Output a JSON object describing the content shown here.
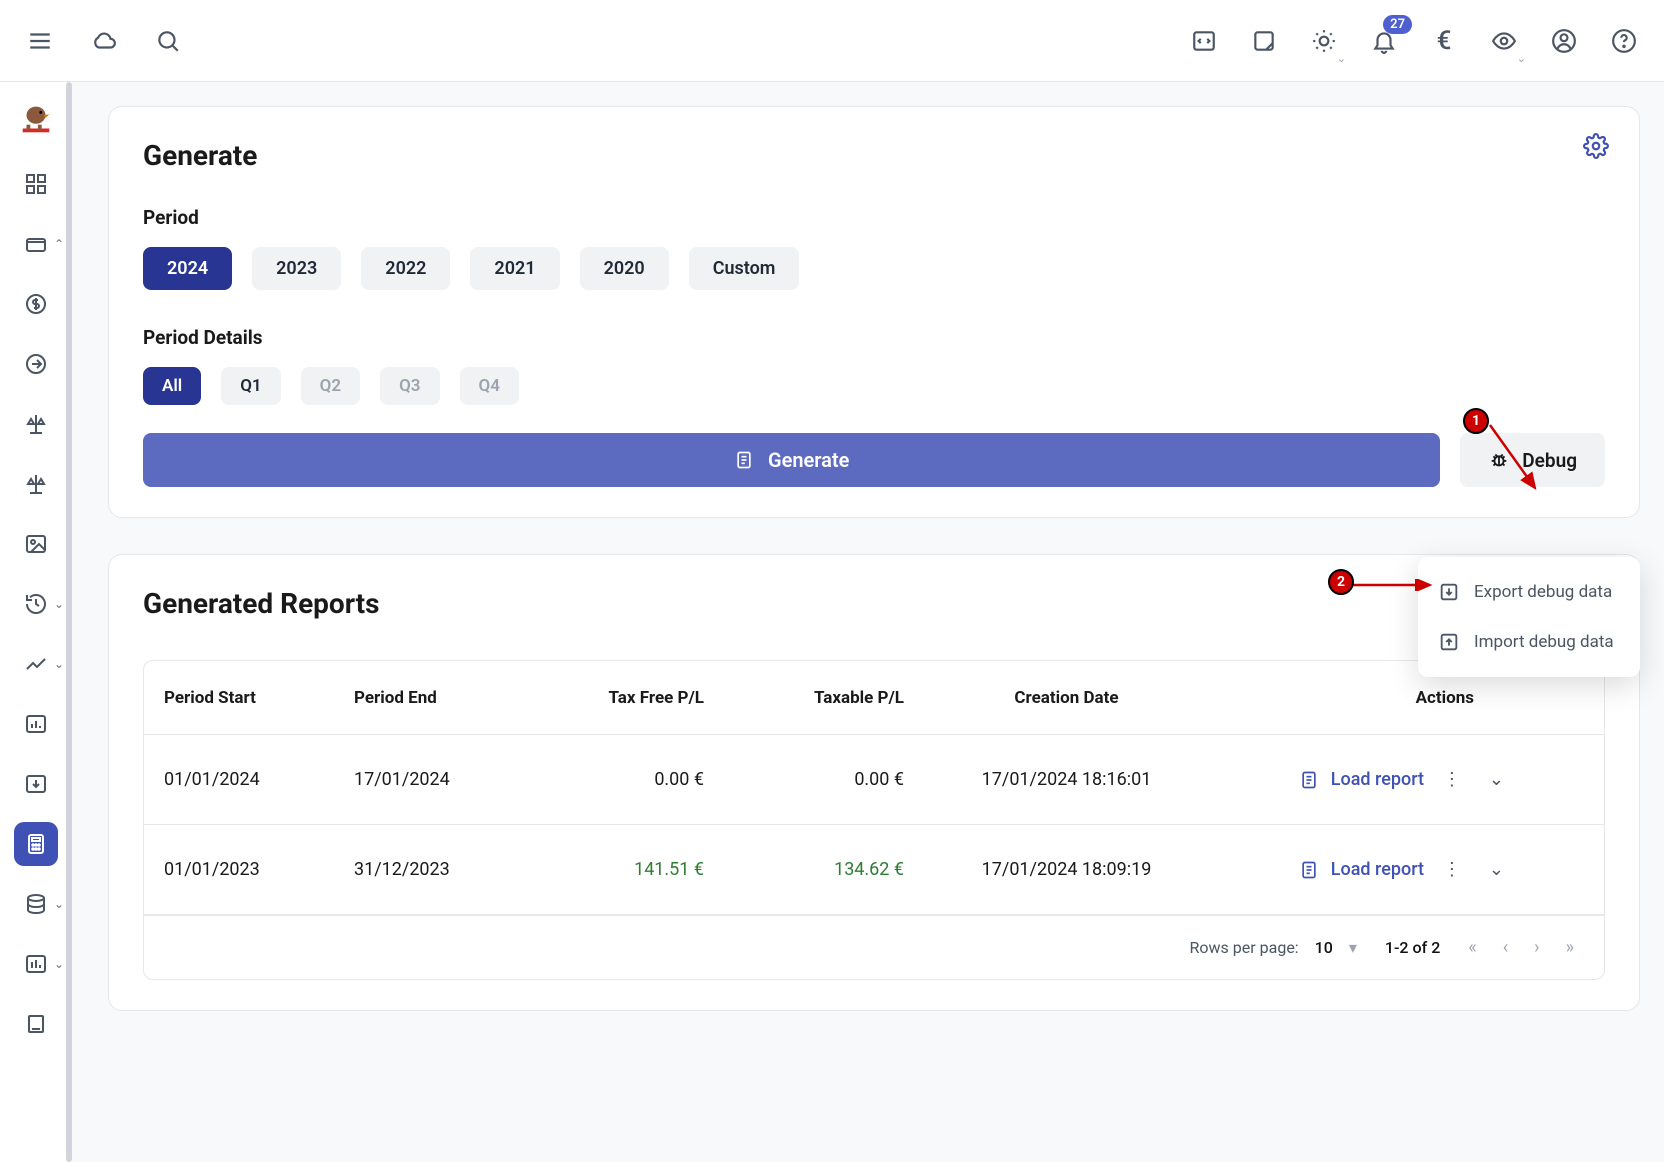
{
  "topbar": {
    "notification_count": "27",
    "currency_symbol": "€"
  },
  "generate": {
    "title": "Generate",
    "period_label": "Period",
    "periods": [
      "2024",
      "2023",
      "2022",
      "2021",
      "2020",
      "Custom"
    ],
    "period_active_index": 0,
    "details_label": "Period Details",
    "details": [
      {
        "label": "All",
        "state": "active"
      },
      {
        "label": "Q1",
        "state": "enabled"
      },
      {
        "label": "Q2",
        "state": "disabled"
      },
      {
        "label": "Q3",
        "state": "disabled"
      },
      {
        "label": "Q4",
        "state": "disabled"
      }
    ],
    "generate_btn": "Generate",
    "debug_btn": "Debug"
  },
  "debug_menu": {
    "export": "Export debug data",
    "import": "Import debug data"
  },
  "reports": {
    "title": "Generated Reports",
    "columns": {
      "period_start": "Period Start",
      "period_end": "Period End",
      "tax_free": "Tax Free P/L",
      "taxable": "Taxable P/L",
      "creation": "Creation Date",
      "actions": "Actions"
    },
    "rows": [
      {
        "period_start": "01/01/2024",
        "period_end": "17/01/2024",
        "tax_free": "0.00 €",
        "taxable": "0.00 €",
        "tax_class": "",
        "creation": "17/01/2024 18:16:01",
        "load": "Load report"
      },
      {
        "period_start": "01/01/2023",
        "period_end": "31/12/2023",
        "tax_free": "141.51 €",
        "taxable": "134.62 €",
        "tax_class": "green",
        "creation": "17/01/2024 18:09:19",
        "load": "Load report"
      }
    ],
    "footer": {
      "rows_per_page_label": "Rows per page:",
      "rows_per_page_value": "10",
      "range": "1-2 of 2"
    }
  },
  "annotations": {
    "c1": "1",
    "c2": "2"
  }
}
